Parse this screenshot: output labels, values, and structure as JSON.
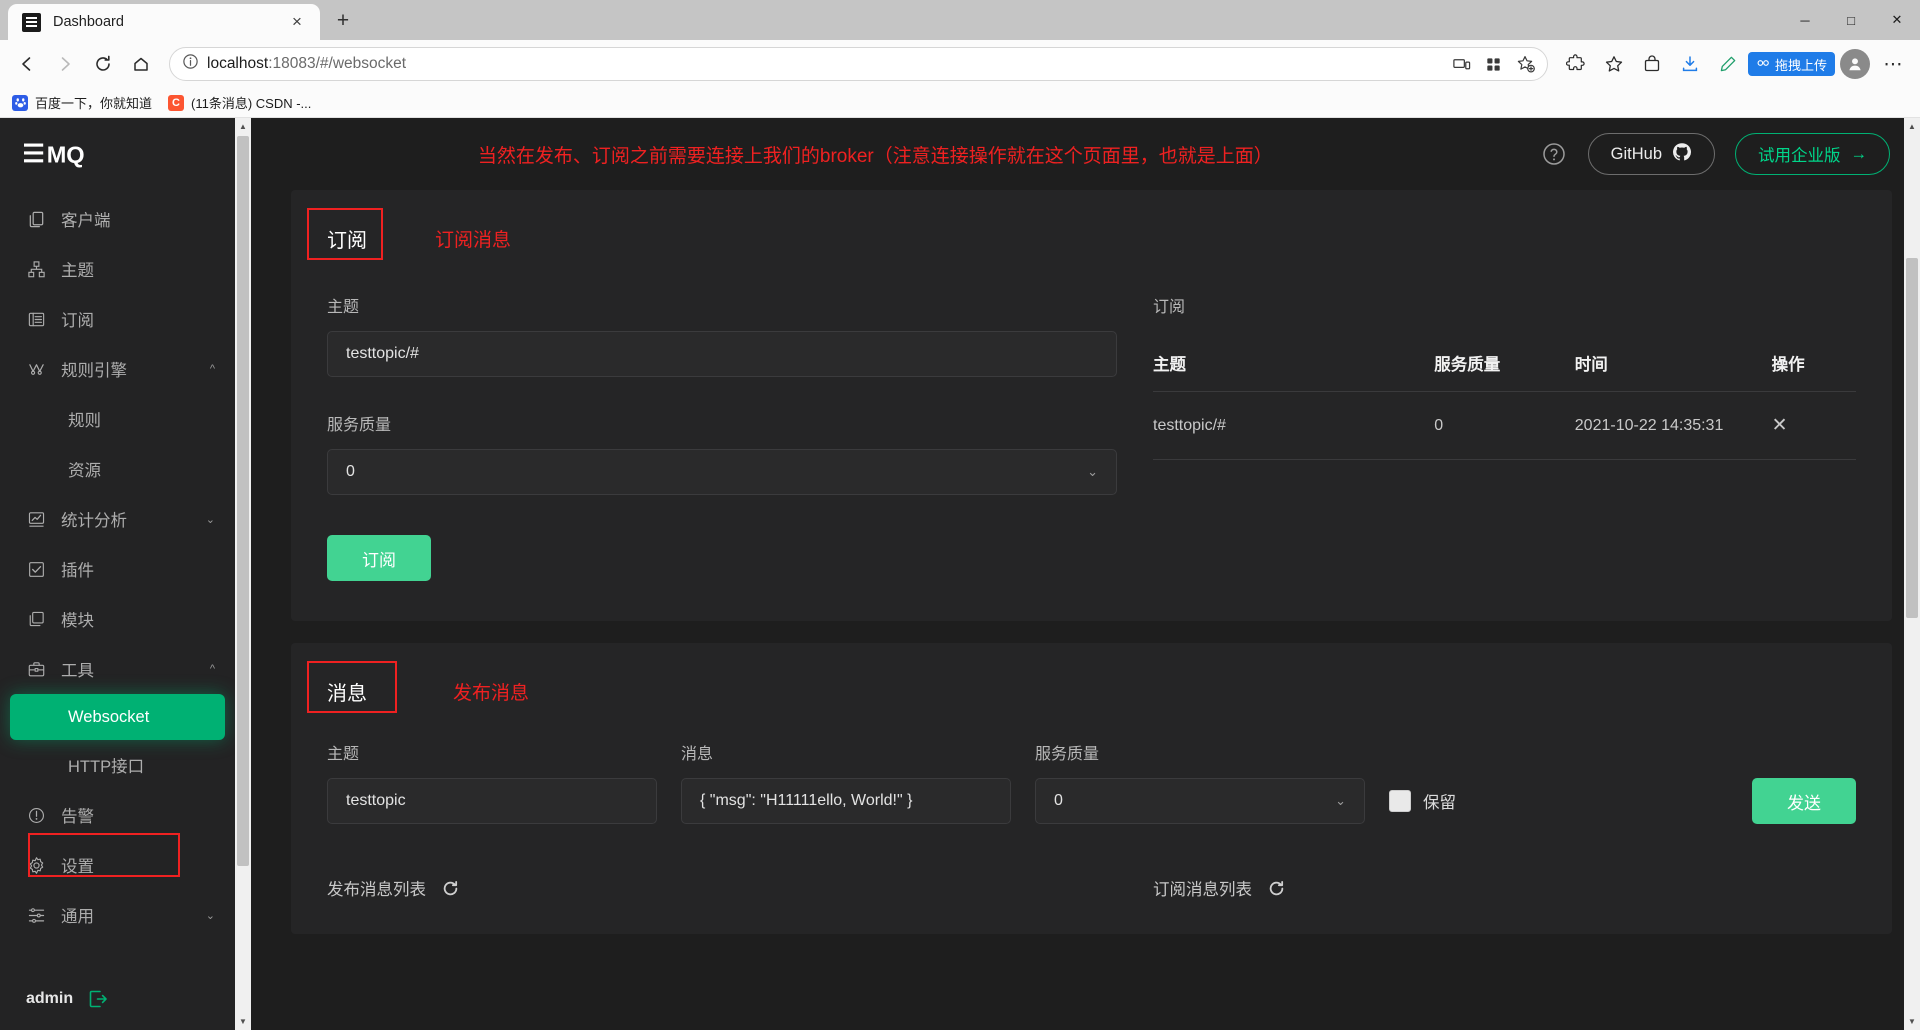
{
  "browser": {
    "tab": {
      "title": "Dashboard",
      "favicon": "emq-logo-icon",
      "close_label": "×"
    },
    "new_tab_label": "+",
    "window_controls": {
      "minimize": "─",
      "maximize": "□",
      "close": "✕"
    },
    "nav": {
      "back": "←",
      "forward": "→",
      "reload": "⟳",
      "home": "⌂"
    },
    "omnibox": {
      "info_icon": "info-circle-icon",
      "url_host": "localhost",
      "url_rest": ":18083/#/websocket",
      "full_url": "localhost:18083/#/websocket"
    },
    "toolbar_icons": [
      "cast-device-icon",
      "collections-icon",
      "add-favorite-icon",
      "extensions-icon",
      "favorites-icon",
      "shopping-icon",
      "downloads-icon",
      "edit-icon"
    ],
    "upload_pill": {
      "label": "拖拽上传",
      "color": "#1f7ce8"
    },
    "profile": "profile-avatar",
    "more": "⋯",
    "bookmarks": [
      {
        "label": "百度一下，你就知道",
        "icon": "baidu-icon",
        "icon_color": "#2d5ce6",
        "icon_text": "☺"
      },
      {
        "label": "(11条消息) CSDN -...",
        "icon": "csdn-icon",
        "icon_color": "#fc5531",
        "icon_text": "C"
      }
    ]
  },
  "app": {
    "brand": "EMQ",
    "sidebar": {
      "items": [
        {
          "label": "客户端",
          "icon": "clients-icon",
          "type": "item"
        },
        {
          "label": "主题",
          "icon": "topics-icon",
          "type": "item"
        },
        {
          "label": "订阅",
          "icon": "subscriptions-icon",
          "type": "item"
        },
        {
          "label": "规则引擎",
          "icon": "rule-engine-icon",
          "type": "item",
          "chev": "expanded"
        },
        {
          "label": "规则",
          "type": "sub"
        },
        {
          "label": "资源",
          "type": "sub"
        },
        {
          "label": "统计分析",
          "icon": "analytics-icon",
          "type": "item",
          "chev": "collapsed"
        },
        {
          "label": "插件",
          "icon": "plugins-icon",
          "type": "item"
        },
        {
          "label": "模块",
          "icon": "modules-icon",
          "type": "item"
        },
        {
          "label": "工具",
          "icon": "tools-icon",
          "type": "item",
          "chev": "expanded"
        },
        {
          "label": "Websocket",
          "type": "sub",
          "active": true
        },
        {
          "label": "HTTP接口",
          "type": "sub"
        },
        {
          "label": "告警",
          "icon": "alarm-icon",
          "type": "item"
        },
        {
          "label": "设置",
          "icon": "settings-icon",
          "type": "item"
        },
        {
          "label": "通用",
          "icon": "general-icon",
          "type": "item",
          "chev": "collapsed"
        }
      ],
      "user": "admin",
      "logout_icon": "logout-icon"
    },
    "topbar": {
      "note": "当然在发布、订阅之前需要连接上我们的broker（注意连接操作就在这个页面里，也就是上面）",
      "help_icon": "help-circle-icon",
      "github_label": "GitHub",
      "github_icon": "github-icon",
      "enterprise_label": "试用企业版",
      "enterprise_arrow": "→"
    },
    "subscribe_card": {
      "title": "订阅",
      "note": "订阅消息",
      "topic_label": "主题",
      "topic_value": "testtopic/#",
      "qos_label": "服务质量",
      "qos_value": "0",
      "submit_label": "订阅",
      "table_title": "订阅",
      "columns": [
        "主题",
        "服务质量",
        "时间",
        "操作"
      ],
      "rows": [
        {
          "topic": "testtopic/#",
          "qos": "0",
          "time": "2021-10-22 14:35:31",
          "action": "✕"
        }
      ]
    },
    "publish_card": {
      "title": "消息",
      "note": "发布消息",
      "topic_label": "主题",
      "topic_value": "testtopic",
      "message_label": "消息",
      "message_value": "{ \"msg\": \"H11111ello, World!\" }",
      "qos_label": "服务质量",
      "qos_value": "0",
      "retain_label": "保留",
      "retain_checked": false,
      "send_label": "发送",
      "publish_list_label": "发布消息列表",
      "subscribe_list_label": "订阅消息列表",
      "refresh_icon": "refresh-icon"
    },
    "colors": {
      "accent_green": "#00b173",
      "button_green": "#42d392",
      "annotation_red": "#ef2121",
      "sidebar_bg": "#232324",
      "page_bg": "#1e1e1e",
      "card_bg": "#252526"
    }
  }
}
